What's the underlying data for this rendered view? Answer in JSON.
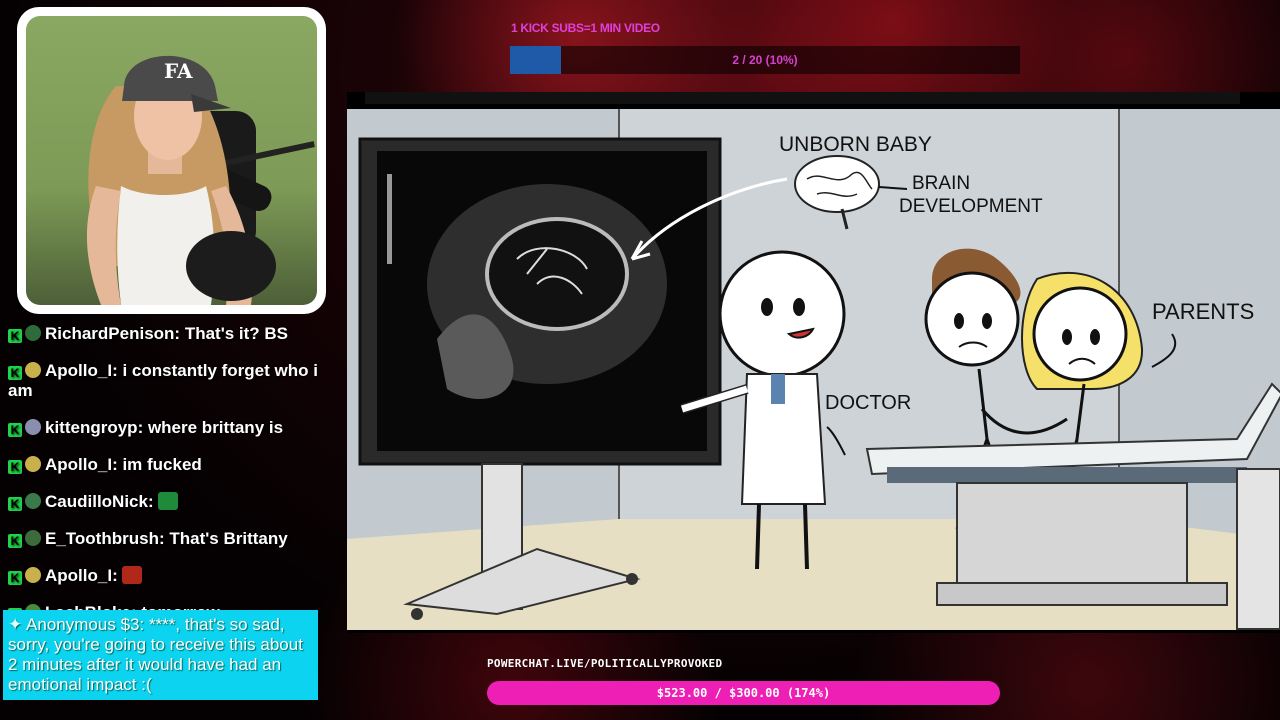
{
  "top_goal": {
    "label": "1 KICK SUBS=1 MIN VIDEO",
    "progress_text": "2 / 20 (10%)",
    "progress_fraction": 0.1
  },
  "video": {
    "labels": {
      "unborn_baby": "UNBORN BABY",
      "brain_development_1": "BRAIN",
      "brain_development_2": "DEVELOPMENT",
      "parents": "PARENTS",
      "doctor": "DOCTOR"
    }
  },
  "chat": {
    "messages": [
      {
        "user": "RichardPenison",
        "text": "That's it? BS",
        "avatar_color": "#2d6b3a"
      },
      {
        "user": "Apollo_I",
        "text": "i constantly forget who i am",
        "avatar_color": "#c8b04a"
      },
      {
        "user": "kittengroyp",
        "text": "where brittany is",
        "avatar_color": "#8a8fb0"
      },
      {
        "user": "Apollo_I",
        "text": "im fucked",
        "avatar_color": "#c8b04a"
      },
      {
        "user": "CaudilloNick",
        "text": "",
        "avatar_color": "#3a7a4a",
        "emote": "green-bag-emote"
      },
      {
        "user": "E_Toothbrush",
        "text": "That's Brittany",
        "avatar_color": "#3b6a3b"
      },
      {
        "user": "Apollo_I",
        "text": "",
        "avatar_color": "#c8b04a",
        "emote": "red-face-emote"
      },
      {
        "user": "LachBloke",
        "text": "tomorrow",
        "avatar_color": "#4a8a3a"
      }
    ],
    "donation": {
      "user": "Anonymous",
      "amount": "$3",
      "text": "****, that's so sad, sorry, you're going to receive this about 2 minutes after it would have had an emotional impact :("
    }
  },
  "powerchat": {
    "url": "POWERCHAT.LIVE/POLITICALLYPROVOKED",
    "goal_text": "$523.00 / $300.00 (174%)"
  },
  "colors": {
    "kick_green": "#1fd34a",
    "donation_bg": "#0bd3f0",
    "powerchat_pink": "#ee1fb5",
    "sub_goal_fill": "#1e5aa8"
  }
}
